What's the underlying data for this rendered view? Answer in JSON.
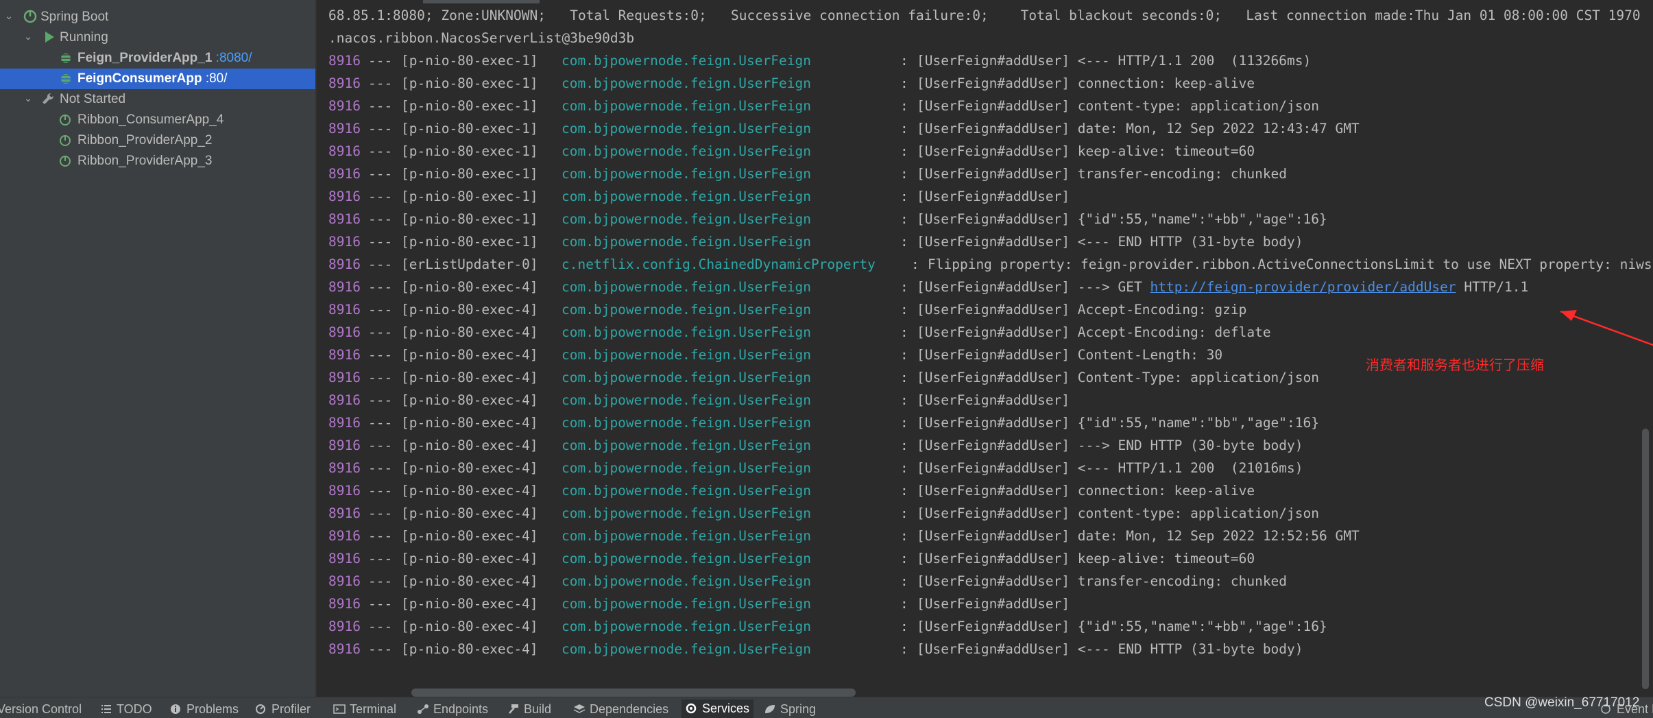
{
  "tree": {
    "root": {
      "label": "Spring Boot"
    },
    "groups": [
      {
        "label": "Running",
        "items": [
          {
            "name": "Feign_ProviderApp_1",
            "port": " :8080/"
          },
          {
            "name": "FeignConsumerApp",
            "port": " :80/"
          }
        ]
      },
      {
        "label": "Not Started",
        "items": [
          {
            "name": "Ribbon_ConsumerApp_4"
          },
          {
            "name": "Ribbon_ProviderApp_2"
          },
          {
            "name": "Ribbon_ProviderApp_3"
          }
        ]
      }
    ]
  },
  "console": {
    "header_lines": [
      "68.85.1:8080; Zone:UNKNOWN;   Total Requests:0;   Successive connection failure:0;    Total blackout seconds:0;   Last connection made:Thu Jan 01 08:00:00 CST 1970",
      ".nacos.ribbon.NacosServerList@3be90d3b"
    ],
    "log_lines": [
      {
        "pid": "8916",
        "dash": "---",
        "thread": "[p-nio-80-exec-1]",
        "logger": "com.bjpowernode.feign.UserFeign",
        "msg": "[UserFeign#addUser] <--- HTTP/1.1 200  (113266ms)"
      },
      {
        "pid": "8916",
        "dash": "---",
        "thread": "[p-nio-80-exec-1]",
        "logger": "com.bjpowernode.feign.UserFeign",
        "msg": "[UserFeign#addUser] connection: keep-alive"
      },
      {
        "pid": "8916",
        "dash": "---",
        "thread": "[p-nio-80-exec-1]",
        "logger": "com.bjpowernode.feign.UserFeign",
        "msg": "[UserFeign#addUser] content-type: application/json"
      },
      {
        "pid": "8916",
        "dash": "---",
        "thread": "[p-nio-80-exec-1]",
        "logger": "com.bjpowernode.feign.UserFeign",
        "msg": "[UserFeign#addUser] date: Mon, 12 Sep 2022 12:43:47 GMT"
      },
      {
        "pid": "8916",
        "dash": "---",
        "thread": "[p-nio-80-exec-1]",
        "logger": "com.bjpowernode.feign.UserFeign",
        "msg": "[UserFeign#addUser] keep-alive: timeout=60"
      },
      {
        "pid": "8916",
        "dash": "---",
        "thread": "[p-nio-80-exec-1]",
        "logger": "com.bjpowernode.feign.UserFeign",
        "msg": "[UserFeign#addUser] transfer-encoding: chunked"
      },
      {
        "pid": "8916",
        "dash": "---",
        "thread": "[p-nio-80-exec-1]",
        "logger": "com.bjpowernode.feign.UserFeign",
        "msg": "[UserFeign#addUser]"
      },
      {
        "pid": "8916",
        "dash": "---",
        "thread": "[p-nio-80-exec-1]",
        "logger": "com.bjpowernode.feign.UserFeign",
        "msg": "[UserFeign#addUser] {\"id\":55,\"name\":\"+bb\",\"age\":16}"
      },
      {
        "pid": "8916",
        "dash": "---",
        "thread": "[p-nio-80-exec-1]",
        "logger": "com.bjpowernode.feign.UserFeign",
        "msg": "[UserFeign#addUser] <--- END HTTP (31-byte body)"
      },
      {
        "pid": "8916",
        "dash": "---",
        "thread": "[erListUpdater-0]",
        "logger": "c.netflix.config.ChainedDynamicProperty",
        "msg": "Flipping property: feign-provider.ribbon.ActiveConnectionsLimit to use NEXT property: niws"
      },
      {
        "pid": "8916",
        "dash": "---",
        "thread": "[p-nio-80-exec-4]",
        "logger": "com.bjpowernode.feign.UserFeign",
        "msg": "[UserFeign#addUser] ---> GET ",
        "link": "http://feign-provider/provider/addUser",
        "msg_after": " HTTP/1.1"
      },
      {
        "pid": "8916",
        "dash": "---",
        "thread": "[p-nio-80-exec-4]",
        "logger": "com.bjpowernode.feign.UserFeign",
        "msg": "[UserFeign#addUser] Accept-Encoding: gzip"
      },
      {
        "pid": "8916",
        "dash": "---",
        "thread": "[p-nio-80-exec-4]",
        "logger": "com.bjpowernode.feign.UserFeign",
        "msg": "[UserFeign#addUser] Accept-Encoding: deflate"
      },
      {
        "pid": "8916",
        "dash": "---",
        "thread": "[p-nio-80-exec-4]",
        "logger": "com.bjpowernode.feign.UserFeign",
        "msg": "[UserFeign#addUser] Content-Length: 30"
      },
      {
        "pid": "8916",
        "dash": "---",
        "thread": "[p-nio-80-exec-4]",
        "logger": "com.bjpowernode.feign.UserFeign",
        "msg": "[UserFeign#addUser] Content-Type: application/json"
      },
      {
        "pid": "8916",
        "dash": "---",
        "thread": "[p-nio-80-exec-4]",
        "logger": "com.bjpowernode.feign.UserFeign",
        "msg": "[UserFeign#addUser]"
      },
      {
        "pid": "8916",
        "dash": "---",
        "thread": "[p-nio-80-exec-4]",
        "logger": "com.bjpowernode.feign.UserFeign",
        "msg": "[UserFeign#addUser] {\"id\":55,\"name\":\"bb\",\"age\":16}"
      },
      {
        "pid": "8916",
        "dash": "---",
        "thread": "[p-nio-80-exec-4]",
        "logger": "com.bjpowernode.feign.UserFeign",
        "msg": "[UserFeign#addUser] ---> END HTTP (30-byte body)"
      },
      {
        "pid": "8916",
        "dash": "---",
        "thread": "[p-nio-80-exec-4]",
        "logger": "com.bjpowernode.feign.UserFeign",
        "msg": "[UserFeign#addUser] <--- HTTP/1.1 200  (21016ms)"
      },
      {
        "pid": "8916",
        "dash": "---",
        "thread": "[p-nio-80-exec-4]",
        "logger": "com.bjpowernode.feign.UserFeign",
        "msg": "[UserFeign#addUser] connection: keep-alive"
      },
      {
        "pid": "8916",
        "dash": "---",
        "thread": "[p-nio-80-exec-4]",
        "logger": "com.bjpowernode.feign.UserFeign",
        "msg": "[UserFeign#addUser] content-type: application/json"
      },
      {
        "pid": "8916",
        "dash": "---",
        "thread": "[p-nio-80-exec-4]",
        "logger": "com.bjpowernode.feign.UserFeign",
        "msg": "[UserFeign#addUser] date: Mon, 12 Sep 2022 12:52:56 GMT"
      },
      {
        "pid": "8916",
        "dash": "---",
        "thread": "[p-nio-80-exec-4]",
        "logger": "com.bjpowernode.feign.UserFeign",
        "msg": "[UserFeign#addUser] keep-alive: timeout=60"
      },
      {
        "pid": "8916",
        "dash": "---",
        "thread": "[p-nio-80-exec-4]",
        "logger": "com.bjpowernode.feign.UserFeign",
        "msg": "[UserFeign#addUser] transfer-encoding: chunked"
      },
      {
        "pid": "8916",
        "dash": "---",
        "thread": "[p-nio-80-exec-4]",
        "logger": "com.bjpowernode.feign.UserFeign",
        "msg": "[UserFeign#addUser]"
      },
      {
        "pid": "8916",
        "dash": "---",
        "thread": "[p-nio-80-exec-4]",
        "logger": "com.bjpowernode.feign.UserFeign",
        "msg": "[UserFeign#addUser] {\"id\":55,\"name\":\"+bb\",\"age\":16}"
      },
      {
        "pid": "8916",
        "dash": "---",
        "thread": "[p-nio-80-exec-4]",
        "logger": "com.bjpowernode.feign.UserFeign",
        "msg": "[UserFeign#addUser] <--- END HTTP (31-byte body)"
      }
    ],
    "annotation": "消费者和服务者也进行了压缩"
  },
  "toolbar": {
    "items": [
      {
        "label": "Version Control",
        "icon": "version-control-icon"
      },
      {
        "label": "TODO",
        "icon": "list-icon"
      },
      {
        "label": "Problems",
        "icon": "info-icon"
      },
      {
        "label": "Profiler",
        "icon": "profiler-icon"
      },
      {
        "label": "Terminal",
        "icon": "terminal-icon"
      },
      {
        "label": "Endpoints",
        "icon": "endpoints-icon"
      },
      {
        "label": "Build",
        "icon": "hammer-icon"
      },
      {
        "label": "Dependencies",
        "icon": "layers-icon"
      },
      {
        "label": "Services",
        "icon": "services-icon",
        "active": true
      },
      {
        "label": "Spring",
        "icon": "spring-leaf-icon"
      }
    ],
    "event_log": "Event L"
  },
  "watermark": "CSDN @weixin_67717012",
  "colors": {
    "pid": "#b077c9",
    "logger": "#2fa6a6",
    "link": "#4a8fe7",
    "annotation": "#ff2a2a",
    "selection": "#2f65ca"
  }
}
